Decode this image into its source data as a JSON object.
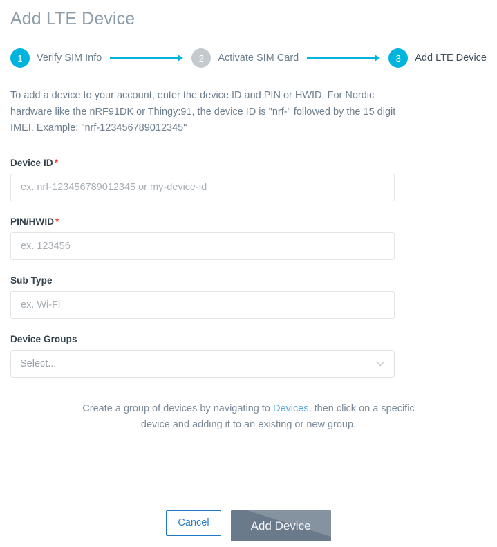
{
  "header": {
    "title": "Add LTE Device"
  },
  "stepper": {
    "steps": [
      {
        "number": "1",
        "label": "Verify SIM Info",
        "state": "done"
      },
      {
        "number": "2",
        "label": "Activate SIM Card",
        "state": "idle"
      },
      {
        "number": "3",
        "label": "Add LTE Device",
        "state": "active"
      }
    ]
  },
  "intro": {
    "text": "To add a device to your account, enter the device ID and PIN or HWID. For Nordic hardware like the nRF91DK or Thingy:91, the device ID is \"nrf-\" followed by the 15 digit IMEI. Example: \"nrf-123456789012345\""
  },
  "form": {
    "fields": [
      {
        "label": "Device ID",
        "required": true,
        "required_marker": "*",
        "value": "",
        "placeholder": "ex. nrf-123456789012345 or my-device-id"
      },
      {
        "label": "PIN/HWID",
        "required": true,
        "required_marker": "*",
        "value": "",
        "placeholder": "ex. 123456"
      },
      {
        "label": "Sub Type",
        "required": false,
        "value": "",
        "placeholder": "ex. Wi-Fi"
      }
    ],
    "device_groups": {
      "label": "Device Groups",
      "selected_label": "Select...",
      "arrow_icon": "chevron-down-icon"
    }
  },
  "helper_note": {
    "before_link": "Create a group of devices by navigating to ",
    "link_label": "Devices",
    "after_link": ", then click on a specific device and adding it to an existing or new group."
  },
  "actions": {
    "cancel_label": "Cancel",
    "submit_label": "Add Device",
    "submit_disabled": true
  },
  "colors": {
    "accent_cyan": "#00b4dd",
    "step_idle_gray": "#c4c9cd",
    "title_gray": "#8d9daa",
    "required_red": "#f4442e",
    "link_blue": "#50a8e0",
    "cancel_blue": "#2b7fc9",
    "submit_gray": "#6a7a8a"
  }
}
